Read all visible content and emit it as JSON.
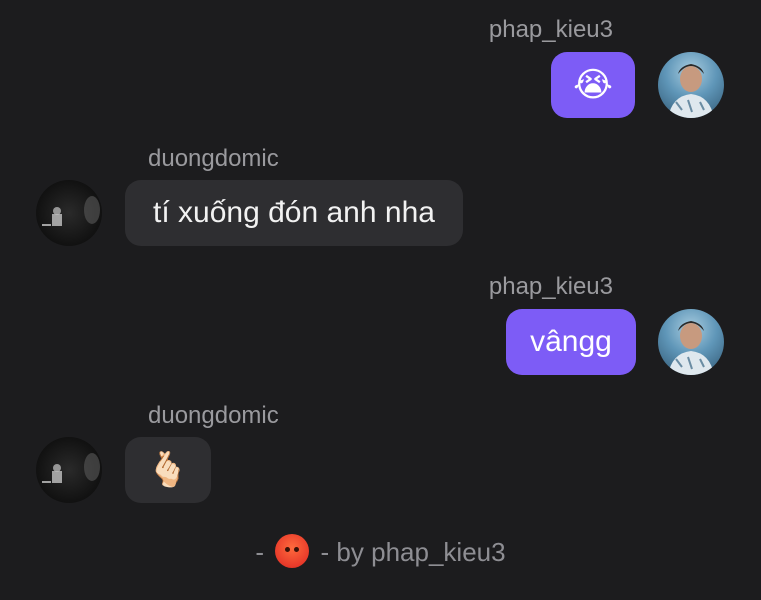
{
  "messages": [
    {
      "sender": "phap_kieu3",
      "direction": "outgoing",
      "content": "😭"
    },
    {
      "sender": "duongdomic",
      "direction": "incoming",
      "content": "tí xuống đón anh nha"
    },
    {
      "sender": "phap_kieu3",
      "direction": "outgoing",
      "content": "vângg"
    },
    {
      "sender": "duongdomic",
      "direction": "incoming",
      "content": "🫰🏻"
    }
  ],
  "footer": {
    "prefix": "-",
    "reaction_icon": "angry-face-icon",
    "suffix": "- by phap_kieu3"
  },
  "colors": {
    "background": "#1c1c1e",
    "outgoing_bubble": "#7d5cf6",
    "incoming_bubble": "#2e2e31",
    "username": "#9a9a9e"
  }
}
